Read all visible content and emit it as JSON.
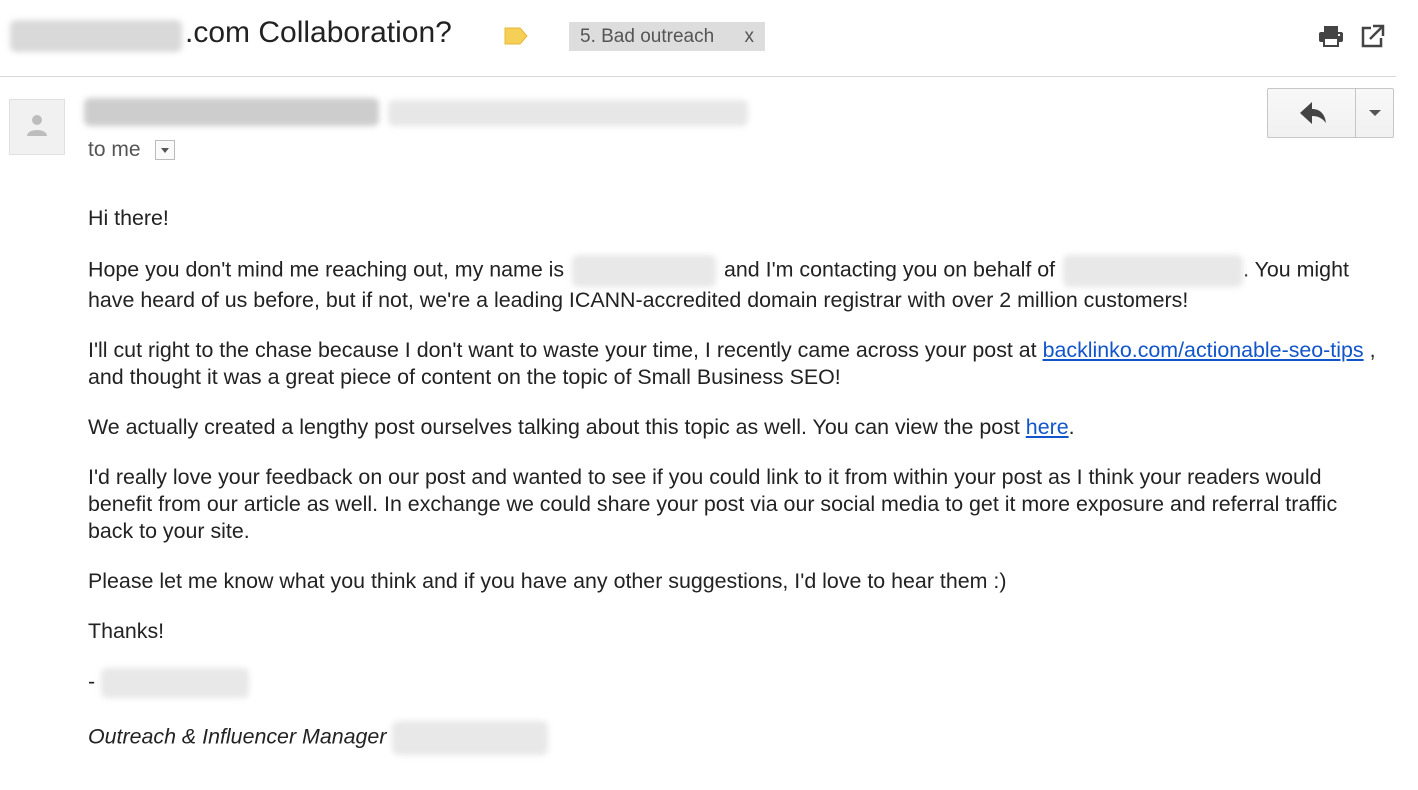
{
  "email": {
    "subject_suffix": ".com Collaboration?",
    "label": {
      "text": "5. Bad outreach",
      "remove": "x"
    },
    "to_me": "to me",
    "greeting": "Hi there!",
    "p1": {
      "part1": "Hope you don't mind me reaching out, my name is",
      "part2": "and I'm contacting you on behalf of",
      "part3": ". You might have heard of us before, but if not, we're a leading ICANN-accredited domain registrar with over 2 million customers!"
    },
    "p2": {
      "part1": "I'll cut right to the chase because I don't want to waste your time, I recently came across your post at",
      "link": "backlinko.com/actionable-seo-tips",
      "part2": ", and thought it was a great piece of content on the topic of Small Business SEO!"
    },
    "p3": {
      "part1": "We actually created a lengthy post ourselves talking about this topic as well. You can view the post",
      "link": "here",
      "part2": "."
    },
    "p4": "I'd really love your feedback on our post and wanted to see if you could link to it from within your post as I think your readers would benefit from our article as well. In exchange we could share your post via our social media to get it more exposure and referral traffic back to your site.",
    "p5": "Please let me know what you think and if you have any other suggestions, I'd love to hear them :)",
    "thanks": "Thanks!",
    "dash": "-",
    "sig_title": "Outreach & Influencer Manager"
  },
  "colors": {
    "link": "#1155cc",
    "label_tag": "#f6cf57",
    "label_chip_bg": "#dddddd"
  },
  "icons": {
    "label": "label-tag-icon",
    "print": "print-icon",
    "popout": "popout-icon",
    "avatar": "person-icon",
    "reply": "reply-arrow-icon",
    "more": "chevron-down-icon"
  }
}
